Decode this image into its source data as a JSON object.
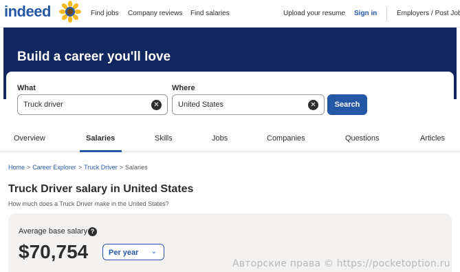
{
  "header": {
    "logo_text": "indeed",
    "nav": {
      "find_jobs": "Find jobs",
      "company_reviews": "Company reviews",
      "find_salaries": "Find salaries",
      "upload_resume": "Upload your resume",
      "sign_in": "Sign in",
      "employers": "Employers / Post Job"
    }
  },
  "hero": {
    "title": "Build a career you'll love"
  },
  "search": {
    "what_label": "What",
    "what_value": "Truck driver",
    "where_label": "Where",
    "where_value": "United States",
    "button_label": "Search"
  },
  "tabs": [
    {
      "label": "Overview"
    },
    {
      "label": "Salaries"
    },
    {
      "label": "Skills"
    },
    {
      "label": "Jobs"
    },
    {
      "label": "Companies"
    },
    {
      "label": "Questions"
    },
    {
      "label": "Articles"
    }
  ],
  "breadcrumb": {
    "items": [
      "Home",
      "Career Explorer",
      "Truck Driver"
    ],
    "current": "Salaries",
    "separator": ">"
  },
  "page": {
    "title": "Truck Driver salary in United States",
    "subtitle": "How much does a Truck Driver make in the United States?"
  },
  "salary": {
    "label": "Average base salary",
    "value": "$70,754",
    "period": "Per year",
    "help_symbol": "?"
  },
  "watermark": "Авторские права © https://pocketoption.ru",
  "colors": {
    "brand_blue": "#2557a7",
    "hero_bg": "#12275f"
  }
}
